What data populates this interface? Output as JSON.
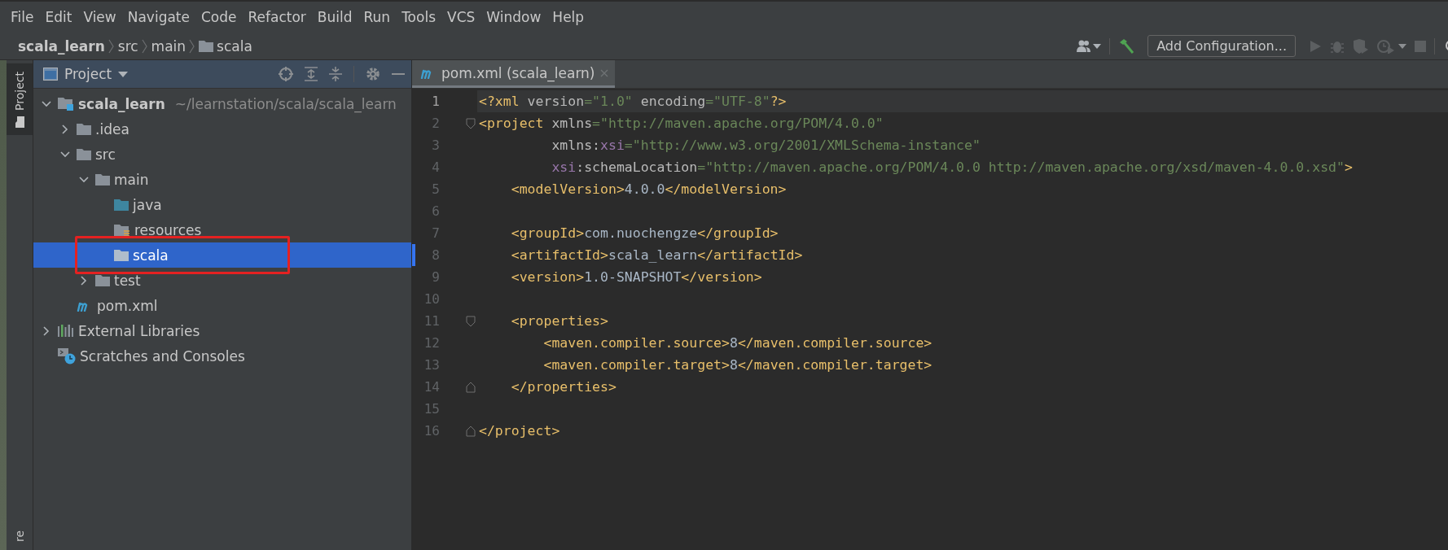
{
  "menu": [
    "File",
    "Edit",
    "View",
    "Navigate",
    "Code",
    "Refactor",
    "Build",
    "Run",
    "Tools",
    "VCS",
    "Window",
    "Help"
  ],
  "breadcrumb": [
    {
      "label": "scala_learn",
      "kind": "project"
    },
    {
      "label": "src",
      "kind": "dir"
    },
    {
      "label": "main",
      "kind": "dir"
    },
    {
      "label": "scala",
      "kind": "folder"
    }
  ],
  "toolbar": {
    "run_config": "Add Configuration..."
  },
  "side_tabs": [
    {
      "label": "Project",
      "selected": true,
      "kind": "top"
    },
    {
      "label": "re",
      "selected": false,
      "kind": "bottom"
    }
  ],
  "project_panel": {
    "title": "Project",
    "tree": [
      {
        "label": "scala_learn",
        "hint": "~/learnstation/scala/scala_learn",
        "kind": "module",
        "expanded": true,
        "selected": false,
        "outlined": false,
        "children": [
          {
            "label": ".idea",
            "kind": "folder",
            "expanded": false,
            "selected": false,
            "outlined": false
          },
          {
            "label": "src",
            "kind": "folder",
            "expanded": true,
            "selected": false,
            "outlined": false,
            "children": [
              {
                "label": "main",
                "kind": "folder",
                "expanded": true,
                "selected": false,
                "outlined": false,
                "children": [
                  {
                    "label": "java",
                    "kind": "source",
                    "selected": false,
                    "outlined": false
                  },
                  {
                    "label": "resources",
                    "kind": "resources",
                    "selected": false,
                    "outlined": false
                  },
                  {
                    "label": "scala",
                    "kind": "folder",
                    "selected": true,
                    "outlined": true
                  }
                ]
              },
              {
                "label": "test",
                "kind": "folder",
                "expanded": false,
                "selected": false,
                "outlined": false
              }
            ]
          },
          {
            "label": "pom.xml",
            "kind": "maven",
            "selected": false,
            "outlined": false
          }
        ]
      },
      {
        "label": "External Libraries",
        "kind": "libraries",
        "expanded": false,
        "selected": false,
        "outlined": false
      },
      {
        "label": "Scratches and Consoles",
        "kind": "scratches",
        "selected": false,
        "outlined": false
      }
    ]
  },
  "editor": {
    "tabs": [
      {
        "label": "pom.xml (scala_learn)",
        "selected": true
      }
    ],
    "lines": [
      {
        "number": "1",
        "kind": "plain",
        "current": true,
        "changed": false,
        "tokens": [
          {
            "text": "<?xml",
            "kind": "tag"
          },
          {
            "text": " version",
            "kind": "attr"
          },
          {
            "text": "=\"1.0\"",
            "kind": "str"
          },
          {
            "text": " encoding",
            "kind": "attr"
          },
          {
            "text": "=\"UTF-8\"",
            "kind": "str"
          },
          {
            "text": "?>",
            "kind": "tag"
          }
        ]
      },
      {
        "number": "2",
        "kind": "fold_start",
        "current": false,
        "changed": false,
        "tokens": [
          {
            "text": "<project",
            "kind": "tag"
          },
          {
            "text": " xmlns",
            "kind": "attr"
          },
          {
            "text": "=\"http://maven.apache.org/POM/4.0.0\"",
            "kind": "str"
          }
        ]
      },
      {
        "number": "3",
        "kind": "plain",
        "current": false,
        "changed": false,
        "tokens": [
          {
            "text": "         xmlns:",
            "kind": "attr"
          },
          {
            "text": "xsi",
            "kind": "ns"
          },
          {
            "text": "=\"http://www.w3.org/2001/XMLSchema-instance\"",
            "kind": "str"
          }
        ]
      },
      {
        "number": "4",
        "kind": "plain",
        "current": false,
        "changed": false,
        "tokens": [
          {
            "text": "         xsi",
            "kind": "ns"
          },
          {
            "text": ":schemaLocation",
            "kind": "attr"
          },
          {
            "text": "=\"http://maven.apache.org/POM/4.0.0 http://maven.apache.org/xsd/maven-4.0.0.xsd\"",
            "kind": "str"
          },
          {
            "text": ">",
            "kind": "tag"
          }
        ]
      },
      {
        "number": "5",
        "kind": "plain",
        "current": false,
        "changed": false,
        "tokens": [
          {
            "text": "    <modelVersion>",
            "kind": "tag"
          },
          {
            "text": "4.0.0",
            "kind": "text"
          },
          {
            "text": "</modelVersion>",
            "kind": "tag"
          }
        ]
      },
      {
        "number": "6",
        "kind": "plain",
        "current": false,
        "changed": false
      },
      {
        "number": "7",
        "kind": "plain",
        "current": false,
        "changed": false,
        "tokens": [
          {
            "text": "    <groupId>",
            "kind": "tag"
          },
          {
            "text": "com.nuochengze",
            "kind": "text"
          },
          {
            "text": "</groupId>",
            "kind": "tag"
          }
        ]
      },
      {
        "number": "8",
        "kind": "plain",
        "current": false,
        "changed": true,
        "tokens": [
          {
            "text": "    <artifactId>",
            "kind": "tag"
          },
          {
            "text": "scala_learn",
            "kind": "text"
          },
          {
            "text": "</artifactId>",
            "kind": "tag"
          }
        ]
      },
      {
        "number": "9",
        "kind": "plain",
        "current": false,
        "changed": false,
        "tokens": [
          {
            "text": "    <version>",
            "kind": "tag"
          },
          {
            "text": "1.0-SNAPSHOT",
            "kind": "text"
          },
          {
            "text": "</version>",
            "kind": "tag"
          }
        ]
      },
      {
        "number": "10",
        "kind": "plain",
        "current": false,
        "changed": false
      },
      {
        "number": "11",
        "kind": "fold_start",
        "current": false,
        "changed": false,
        "tokens": [
          {
            "text": "    <properties>",
            "kind": "tag"
          }
        ]
      },
      {
        "number": "12",
        "kind": "plain",
        "current": false,
        "changed": false,
        "tokens": [
          {
            "text": "        <maven.compiler.source>",
            "kind": "tag"
          },
          {
            "text": "8",
            "kind": "text"
          },
          {
            "text": "</maven.compiler.source>",
            "kind": "tag"
          }
        ]
      },
      {
        "number": "13",
        "kind": "plain",
        "current": false,
        "changed": false,
        "tokens": [
          {
            "text": "        <maven.compiler.target>",
            "kind": "tag"
          },
          {
            "text": "8",
            "kind": "text"
          },
          {
            "text": "</maven.compiler.target>",
            "kind": "tag"
          }
        ]
      },
      {
        "number": "14",
        "kind": "fold_end",
        "current": false,
        "changed": false,
        "tokens": [
          {
            "text": "    </properties>",
            "kind": "tag"
          }
        ]
      },
      {
        "number": "15",
        "kind": "plain",
        "current": false,
        "changed": false
      },
      {
        "number": "16",
        "kind": "fold_end",
        "current": false,
        "changed": false,
        "tokens": [
          {
            "text": "</project>",
            "kind": "tag"
          }
        ]
      }
    ]
  }
}
